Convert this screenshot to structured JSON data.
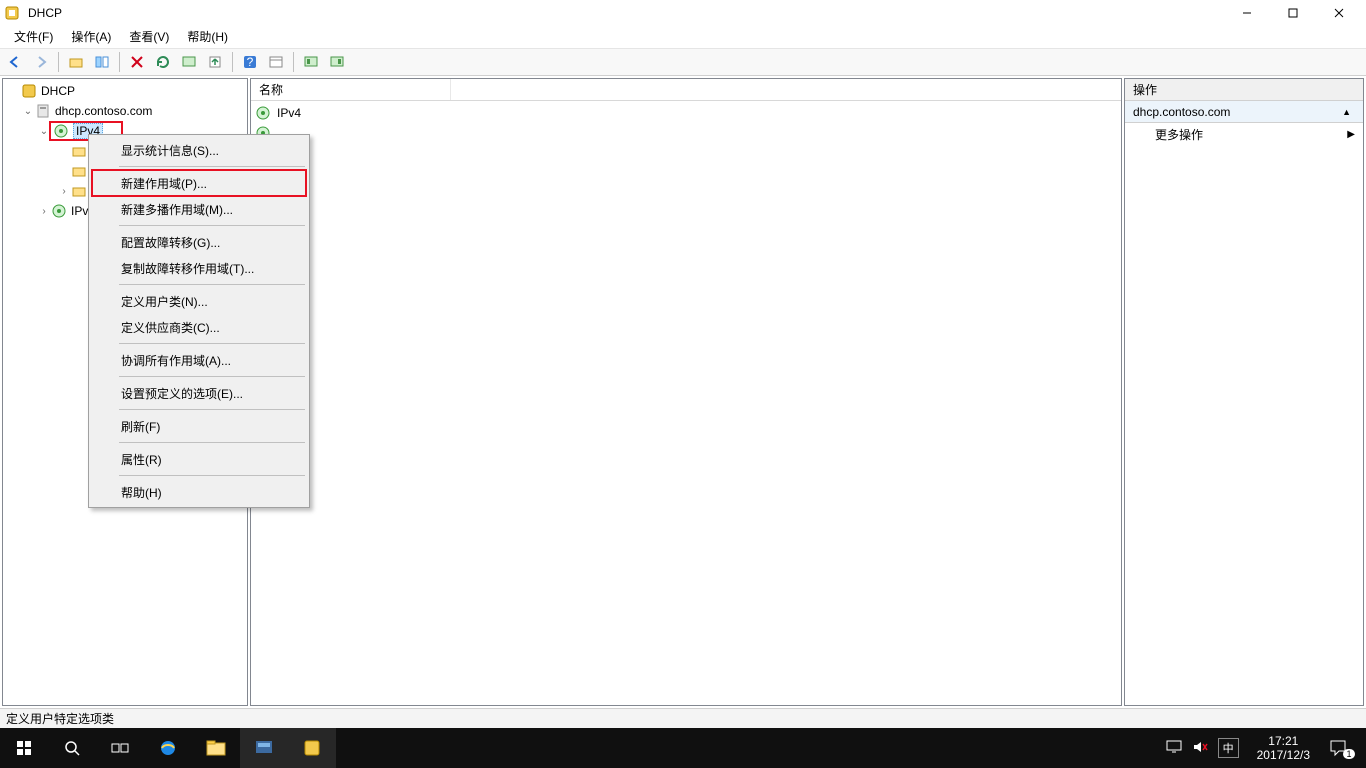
{
  "window": {
    "title": "DHCP",
    "win_buttons": {
      "min": "minimize",
      "max": "maximize",
      "close": "close"
    }
  },
  "menubar": {
    "file": "文件(F)",
    "action": "操作(A)",
    "view": "查看(V)",
    "help": "帮助(H)"
  },
  "toolbar": {
    "back": "back",
    "forward": "forward",
    "up": "up",
    "show_hide": "show/hide",
    "delete": "delete",
    "refresh": "refresh",
    "export": "export",
    "import": "import",
    "help": "help",
    "props": "props",
    "col1": "list",
    "col2": "details"
  },
  "tree": {
    "root": "DHCP",
    "server": "dhcp.contoso.com",
    "ipv4": "IPv4",
    "ipv6": "IPv6",
    "child1": "",
    "child2": "",
    "child3": ""
  },
  "list": {
    "col_name": "名称",
    "items": [
      {
        "label": "IPv4",
        "icon": "ipv"
      },
      {
        "label": "",
        "icon": "ipv"
      }
    ]
  },
  "actions": {
    "header": "操作",
    "scope": "dhcp.contoso.com",
    "more": "更多操作"
  },
  "context_menu": {
    "items": [
      {
        "label": "显示统计信息(S)...",
        "sep_after": true
      },
      {
        "label": "新建作用域(P)...",
        "highlight": true
      },
      {
        "label": "新建多播作用域(M)...",
        "sep_after": true
      },
      {
        "label": "配置故障转移(G)..."
      },
      {
        "label": "复制故障转移作用域(T)...",
        "sep_after": true
      },
      {
        "label": "定义用户类(N)..."
      },
      {
        "label": "定义供应商类(C)...",
        "sep_after": true
      },
      {
        "label": "协调所有作用域(A)...",
        "sep_after": true
      },
      {
        "label": "设置预定义的选项(E)...",
        "sep_after": true
      },
      {
        "label": "刷新(F)",
        "sep_after": true
      },
      {
        "label": "属性(R)",
        "sep_after": true
      },
      {
        "label": "帮助(H)"
      }
    ]
  },
  "statusbar": {
    "text": "定义用户特定选项类"
  },
  "taskbar": {
    "time": "17:21",
    "date": "2017/12/3",
    "ime": "中",
    "notif_count": "1"
  }
}
